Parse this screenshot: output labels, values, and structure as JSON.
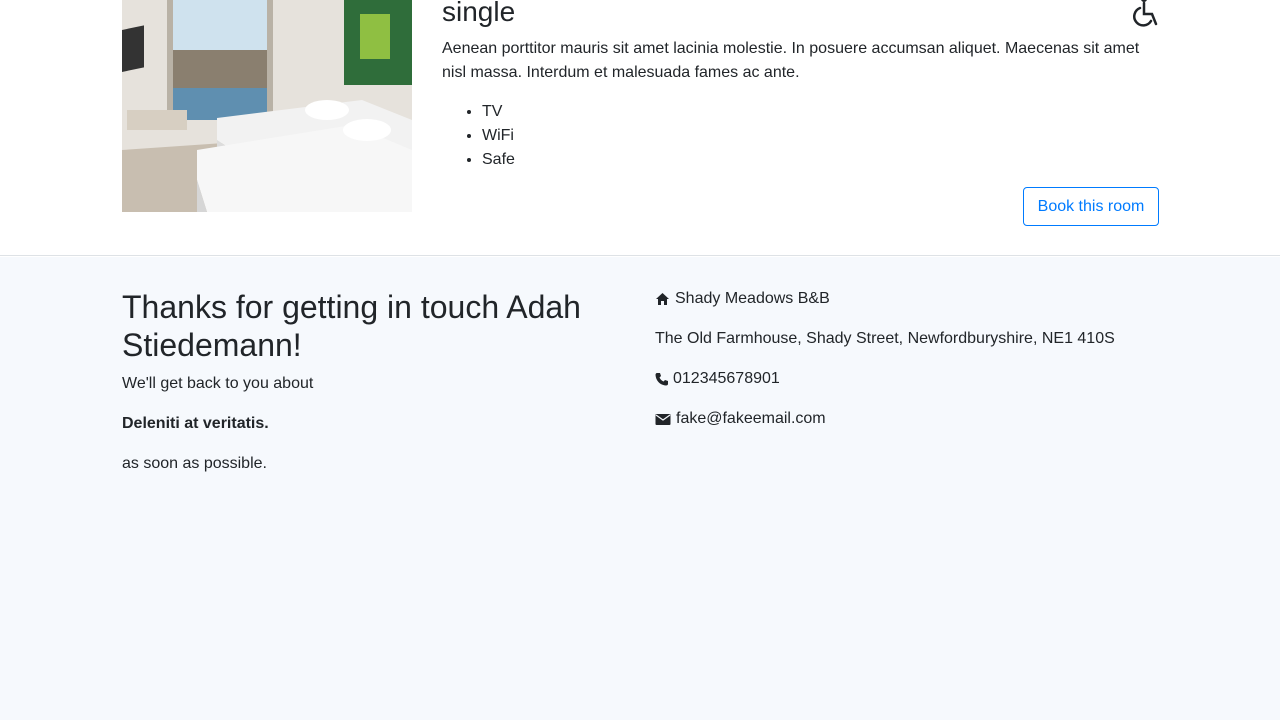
{
  "room": {
    "title": "single",
    "description": "Aenean porttitor mauris sit amet lacinia molestie. In posuere accumsan aliquet. Maecenas sit amet nisl massa. Interdum et malesuada fames ac ante.",
    "amenities": [
      "TV",
      "WiFi",
      "Safe"
    ],
    "book_label": "Book this room",
    "accessible_icon": "wheelchair-icon"
  },
  "contact_confirmation": {
    "title": "Thanks for getting in touch Adah Stiedemann!",
    "line1": "We'll get back to you about",
    "subject": "Deleniti at veritatis.",
    "line2": "as soon as possible."
  },
  "business": {
    "name": "Shady Meadows B&B",
    "address": "The Old Farmhouse, Shady Street, Newfordburyshire, NE1 410S",
    "phone": "012345678901",
    "email": "fake@fakeemail.com",
    "icons": {
      "name": "home-icon",
      "phone": "phone-icon",
      "email": "envelope-icon"
    }
  },
  "colors": {
    "accent": "#007bff",
    "text": "#212529",
    "contact_background": "#f6f9fd"
  }
}
